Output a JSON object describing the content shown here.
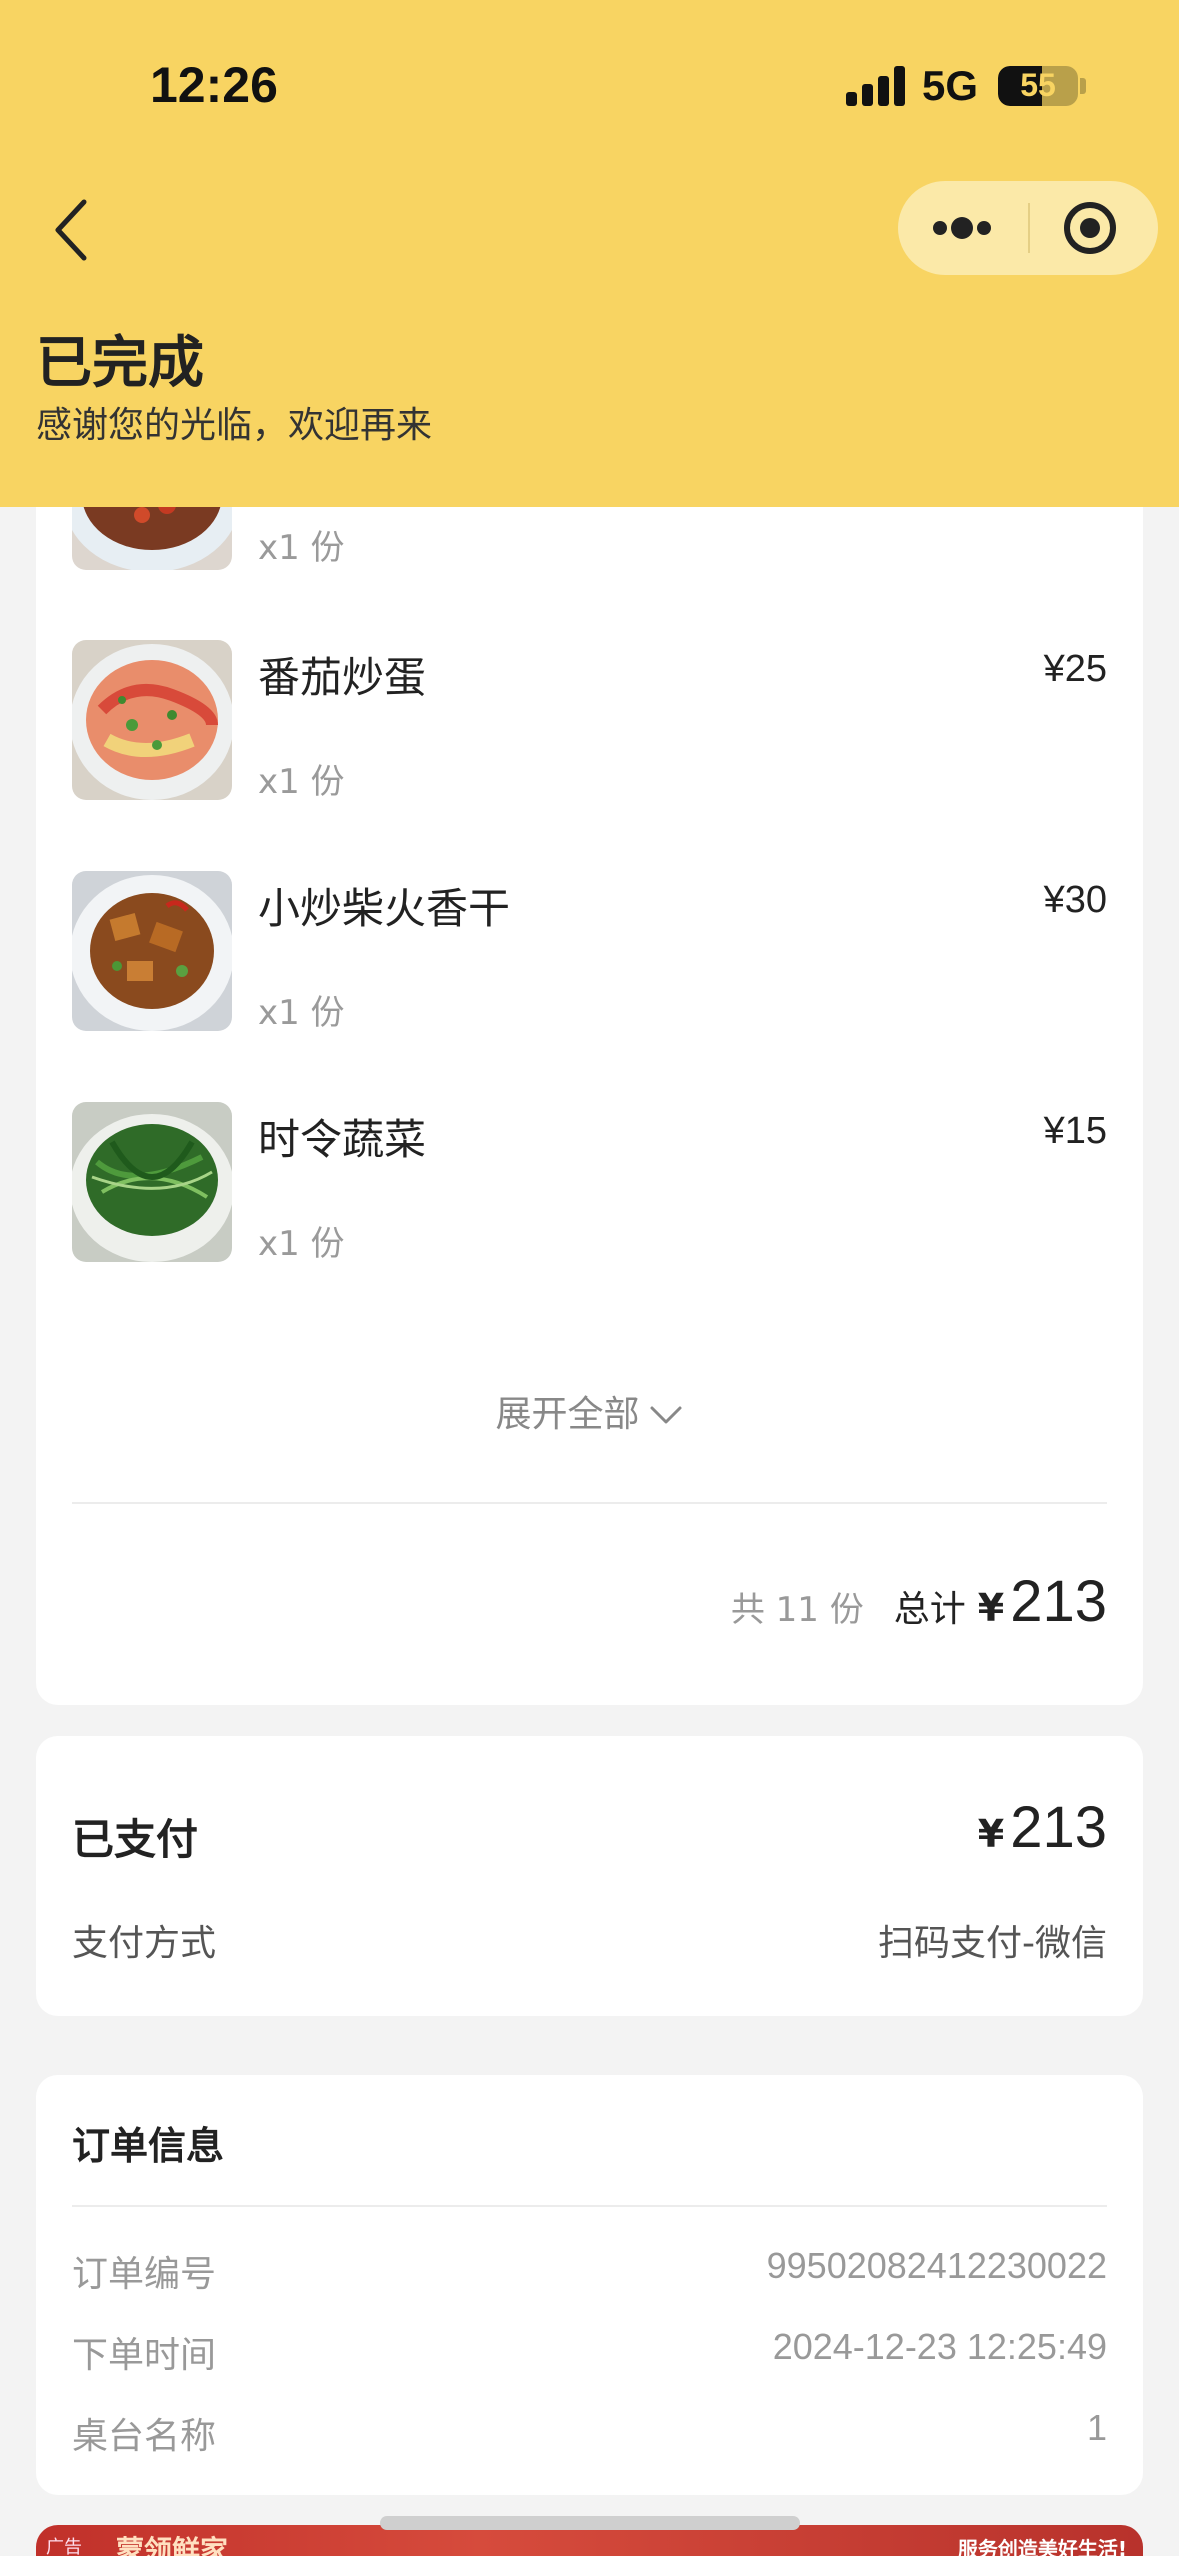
{
  "status_bar": {
    "time": "12:26",
    "network": "5G",
    "battery": "55",
    "battery_level": 0.55
  },
  "header": {
    "title": "已完成",
    "subtitle": "感谢您的光临，欢迎再来",
    "color": "#f8d462"
  },
  "items": [
    {
      "name": "",
      "qty": "x1 份",
      "price": ""
    },
    {
      "name": "番茄炒蛋",
      "qty": "x1 份",
      "price": "¥25"
    },
    {
      "name": "小炒柴火香干",
      "qty": "x1 份",
      "price": "¥30"
    },
    {
      "name": "时令蔬菜",
      "qty": "x1 份",
      "price": "¥15"
    }
  ],
  "expand_label": "展开全部",
  "summary": {
    "count": "共 11 份",
    "total_label": "总计",
    "currency": "¥",
    "total": "213"
  },
  "payment": {
    "label": "已支付",
    "currency": "¥",
    "amount": "213",
    "method_label": "支付方式",
    "method_value": "扫码支付-微信"
  },
  "order_info": {
    "title": "订单信息",
    "rows": [
      {
        "label": "订单编号",
        "value": "99502082412230022"
      },
      {
        "label": "下单时间",
        "value": "2024-12-23 12:25:49"
      },
      {
        "label": "桌台名称",
        "value": "1"
      }
    ]
  },
  "ad": {
    "tag": "广告",
    "text": "蒙领鲜家",
    "slogan": "服务创造美好生活!"
  },
  "icons": [
    "back-icon",
    "more-icon",
    "close-target-icon",
    "chevron-down-icon"
  ]
}
